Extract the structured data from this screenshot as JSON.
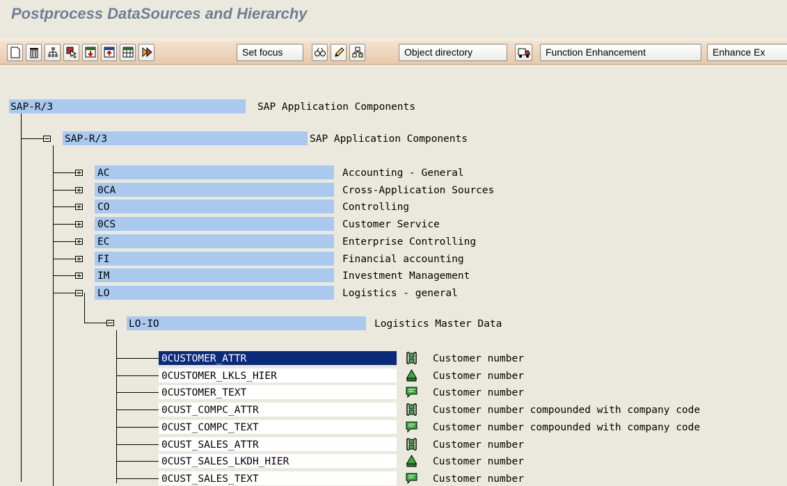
{
  "page": {
    "title": "Postprocess DataSources and Hierarchy"
  },
  "toolbar": {
    "set_focus": "Set focus",
    "object_directory": "Object directory",
    "function_enhancement": "Function Enhancement",
    "enhance": "Enhance Ex"
  },
  "tree": {
    "root": {
      "id": "SAP-R/3",
      "desc": "SAP Application Components"
    },
    "level1": {
      "id": "SAP-R/3",
      "desc": "SAP Application Components"
    },
    "components": [
      {
        "id": "AC",
        "desc": "Accounting - General",
        "expanded": false
      },
      {
        "id": "0CA",
        "desc": "Cross-Application Sources",
        "expanded": false
      },
      {
        "id": "CO",
        "desc": "Controlling",
        "expanded": false
      },
      {
        "id": "0CS",
        "desc": "Customer Service",
        "expanded": false
      },
      {
        "id": "EC",
        "desc": "Enterprise Controlling",
        "expanded": false
      },
      {
        "id": "FI",
        "desc": "Financial accounting",
        "expanded": false
      },
      {
        "id": "IM",
        "desc": "Investment Management",
        "expanded": false
      },
      {
        "id": "LO",
        "desc": "Logistics - general",
        "expanded": true
      }
    ],
    "sub": {
      "id": "LO-IO",
      "desc": "Logistics Master Data"
    },
    "datasources": [
      {
        "id": "0CUSTOMER_ATTR",
        "type": "attr-icon",
        "desc": "Customer number"
      },
      {
        "id": "0CUSTOMER_LKLS_HIER",
        "type": "hierarchy-icon",
        "desc": "Customer number"
      },
      {
        "id": "0CUSTOMER_TEXT",
        "type": "text-icon",
        "desc": "Customer number"
      },
      {
        "id": "0CUST_COMPC_ATTR",
        "type": "attr-icon",
        "desc": "Customer number compounded with company code"
      },
      {
        "id": "0CUST_COMPC_TEXT",
        "type": "text-icon",
        "desc": "Customer number compounded with company code"
      },
      {
        "id": "0CUST_SALES_ATTR",
        "type": "attr-icon",
        "desc": "Customer number"
      },
      {
        "id": "0CUST_SALES_LKDH_HIER",
        "type": "hierarchy-icon",
        "desc": "Customer number"
      },
      {
        "id": "0CUST_SALES_TEXT",
        "type": "text-icon",
        "desc": "Customer number"
      }
    ]
  },
  "colors": {
    "selection": "#0a2a7c",
    "highlight": "#a9c9ee",
    "background": "#ebe9dd",
    "icon_green": "#3aa83a"
  }
}
